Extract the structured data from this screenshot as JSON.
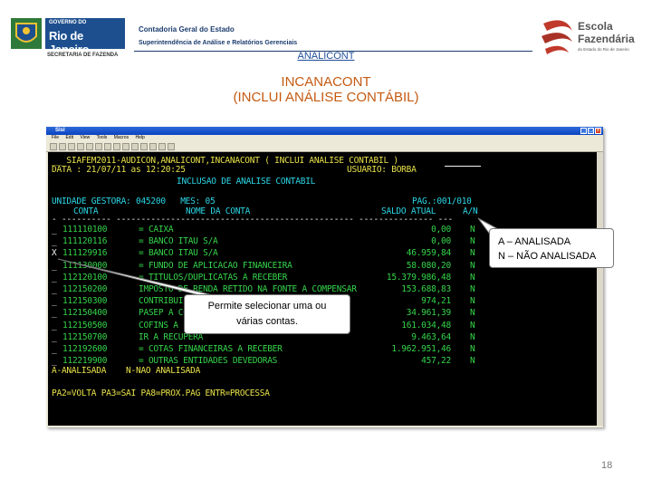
{
  "header": {
    "gov_line1": "GOVERNO DO",
    "gov_line2": "Rio de Janeiro",
    "secretaria": "SECRETARIA DE FAZENDA",
    "line1": "Contadoria Geral do Estado",
    "line2": "Superintendência de Análise e Relatórios Gerenciais",
    "escola_line1": "Escola",
    "escola_line2": "Fazendária",
    "escola_line3": "do Estado do Rio de Janeiro"
  },
  "section_link": "ANALICONT",
  "slide_title": {
    "line1": "INCANACONT",
    "line2": "(INCLUI ANÁLISE CONTÁBIL)"
  },
  "window": {
    "title": "Sisl",
    "menu": [
      "File",
      "Edit",
      "View",
      "Tools",
      "Macros",
      "Help"
    ]
  },
  "terminal": {
    "line1": "__ SIAFEM2011-AUDICON,ANALICONT,INCANACONT ( INCLUI ANALISE CONTABIL )",
    "date_label": "DATA : 21/07/11 as 12:20:25",
    "user_label": "USUARIO: BORBA",
    "subtitle": "INCLUSAO DE ANALISE CONTABIL",
    "unit_line": "UNIDADE GESTORA: 045200   MES: 05",
    "page_label": "PAG.:001/010",
    "col_conta": "CONTA",
    "col_nome": "NOME DA CONTA",
    "col_saldo": "SALDO ATUAL",
    "col_an": "A/N",
    "separator": "- ---------- ------------------------------------------------ --------------- ---",
    "rows": [
      {
        "sel": "_",
        "conta": "111110100",
        "nome": "= CAIXA",
        "saldo": "0,00",
        "an": "N"
      },
      {
        "sel": "_",
        "conta": "111120116",
        "nome": "= BANCO ITAU S/A",
        "saldo": "0,00",
        "an": "N"
      },
      {
        "sel": "X",
        "conta": "111129916",
        "nome": "= BANCO ITAU S/A",
        "saldo": "46.959,84",
        "an": "N"
      },
      {
        "sel": "_",
        "conta": "111130000",
        "nome": "= FUNDO DE APLICACAO FINANCEIRA",
        "saldo": "58.080,20",
        "an": "N"
      },
      {
        "sel": "_",
        "conta": "112120100",
        "nome": "= TITULOS/DUPLICATAS A RECEBER",
        "saldo": "15.379.986,48",
        "an": "N"
      },
      {
        "sel": "_",
        "conta": "112150200",
        "nome": "IMPOSTO DE RENDA RETIDO NA FONTE A COMPENSAR",
        "saldo": "153.688,83",
        "an": "N"
      },
      {
        "sel": "_",
        "conta": "112150300",
        "nome": "CONTRIBUICAO",
        "saldo": "974,21",
        "an": "N"
      },
      {
        "sel": "_",
        "conta": "112150400",
        "nome": "PASEP A COMP",
        "saldo": "34.961,39",
        "an": "N"
      },
      {
        "sel": "_",
        "conta": "112150500",
        "nome": "COFINS A COM",
        "saldo": "161.034,48",
        "an": "N"
      },
      {
        "sel": "_",
        "conta": "112150700",
        "nome": "IR A RECUPERA",
        "saldo": "9.463,64",
        "an": "N"
      },
      {
        "sel": "_",
        "conta": "112192600",
        "nome": "= COTAS FINANCEIRAS A RECEBER",
        "saldo": "1.962.951,46",
        "an": "N"
      },
      {
        "sel": "_",
        "conta": "112219900",
        "nome": "= OUTRAS ENTIDADES DEVEDORAS",
        "saldo": "457,22",
        "an": "N"
      }
    ],
    "legend": "A-ANALISADA    N-NAO ANALISADA",
    "keys": "PA2=VOLTA PA3=SAI PA8=PROX.PAG ENTR=PROCESSA"
  },
  "callouts": {
    "legend_line1": "A – ANALISADA",
    "legend_line2": "N – NÃO ANALISADA",
    "select_line1": "Permite selecionar uma ou",
    "select_line2": "várias contas."
  },
  "page_number": "18",
  "colors": {
    "terminal_bg": "#000000",
    "terminal_cyan": "#2bd6e6",
    "terminal_yellow": "#e8e24a",
    "terminal_green": "#35d44a",
    "title_orange": "#c55a11",
    "link_blue": "#1f4e9a"
  }
}
